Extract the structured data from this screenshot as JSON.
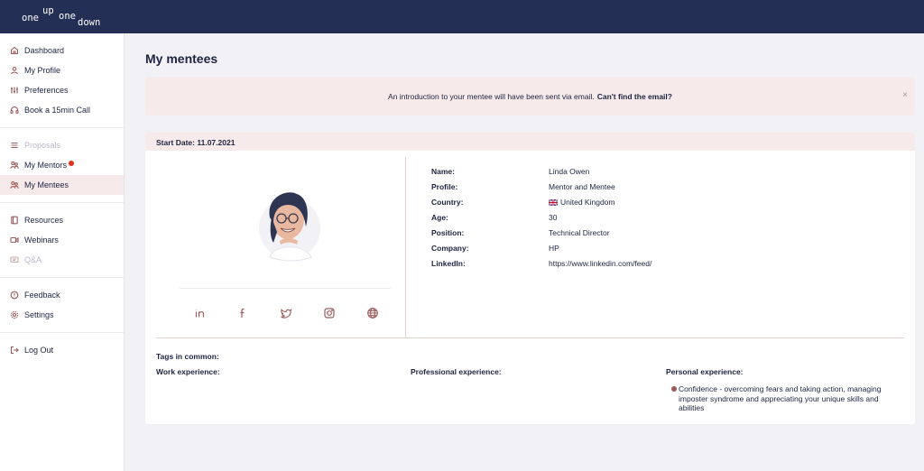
{
  "brand": {
    "logo_words": [
      "one",
      "up",
      "one",
      "down"
    ]
  },
  "sidebar": {
    "groups": [
      [
        {
          "label": "Dashboard",
          "icon": "home-icon"
        },
        {
          "label": "My Profile",
          "icon": "user-icon"
        },
        {
          "label": "Preferences",
          "icon": "sliders-icon"
        },
        {
          "label": "Book a 15min Call",
          "icon": "headset-icon"
        }
      ],
      [
        {
          "label": "Proposals",
          "icon": "list-icon",
          "disabled": true
        },
        {
          "label": "My Mentors",
          "icon": "people-icon",
          "notification": true
        },
        {
          "label": "My Mentees",
          "icon": "people-icon",
          "active": true
        }
      ],
      [
        {
          "label": "Resources",
          "icon": "book-icon"
        },
        {
          "label": "Webinars",
          "icon": "video-icon"
        },
        {
          "label": "Q&A",
          "icon": "chat-icon",
          "disabled": true
        }
      ],
      [
        {
          "label": "Feedback",
          "icon": "feedback-icon"
        },
        {
          "label": "Settings",
          "icon": "gear-icon"
        }
      ],
      [
        {
          "label": "Log Out",
          "icon": "logout-icon"
        }
      ]
    ]
  },
  "main": {
    "title": "My mentees",
    "alert": {
      "text": "An introduction to your mentee will have been sent via email.",
      "link": "Can't find the email?",
      "close": "×"
    },
    "card": {
      "start_date": "Start Date: 11.07.2021",
      "socials": [
        "linkedin-icon",
        "facebook-icon",
        "twitter-icon",
        "instagram-icon",
        "globe-icon"
      ],
      "info": [
        {
          "label": "Name:",
          "value": "Linda Owen"
        },
        {
          "label": "Profile:",
          "value": "Mentor and Mentee"
        },
        {
          "label": "Country:",
          "value": "United Kingdom",
          "flag": true
        },
        {
          "label": "Age:",
          "value": "30"
        },
        {
          "label": "Position:",
          "value": "Technical Director"
        },
        {
          "label": "Company:",
          "value": "HP"
        },
        {
          "label": "LinkedIn:",
          "value": "https://www.linkedin.com/feed/"
        }
      ],
      "tags": {
        "title": "Tags in common:",
        "work_title": "Work experience:",
        "professional_title": "Professional experience:",
        "personal_title": "Personal experience:",
        "personal_items": [
          "Confidence - overcoming fears and taking action, managing imposter syndrome and appreciating your unique skills and abilities"
        ]
      }
    }
  },
  "colors": {
    "topbar": "#242f55",
    "accent": "#9c5a5a",
    "highlight": "#f6eaea",
    "notification": "#e5311b"
  }
}
